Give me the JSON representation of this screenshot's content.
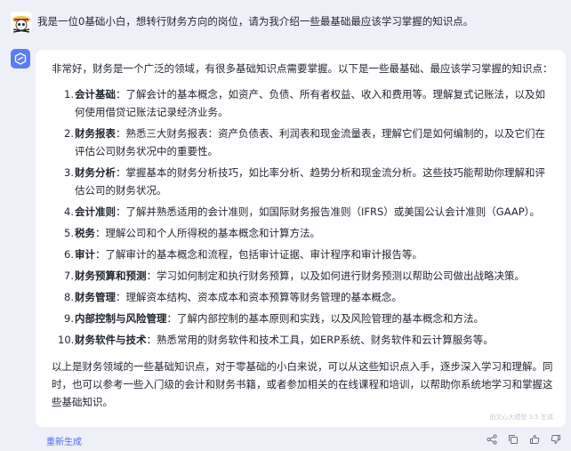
{
  "user": {
    "message": "我是一位0基础小白，想转行财务方向的岗位，请为我介绍一些最基础最应该学习掌握的知识点。"
  },
  "answer": {
    "intro": "非常好，财务是一个广泛的领域，有很多基础知识点需要掌握。以下是一些最基础、最应该学习掌握的知识点：",
    "items": [
      {
        "num": "1.",
        "term": "会计基础",
        "text": "：了解会计的基本概念，如资产、负债、所有者权益、收入和费用等。理解复式记账法，以及如何使用借贷记账法记录经济业务。"
      },
      {
        "num": "2.",
        "term": "财务报表",
        "text": "：熟悉三大财务报表：资产负债表、利润表和现金流量表，理解它们是如何编制的，以及它们在评估公司财务状况中的重要性。"
      },
      {
        "num": "3.",
        "term": "财务分析",
        "text": "：掌握基本的财务分析技巧，如比率分析、趋势分析和现金流分析。这些技巧能帮助你理解和评估公司的财务状况。"
      },
      {
        "num": "4.",
        "term": "会计准则",
        "text": "：了解并熟悉适用的会计准则，如国际财务报告准则（IFRS）或美国公认会计准则（GAAP）。"
      },
      {
        "num": "5.",
        "term": "税务",
        "text": "：理解公司和个人所得税的基本概念和计算方法。"
      },
      {
        "num": "6.",
        "term": "审计",
        "text": "：了解审计的基本概念和流程，包括审计证据、审计程序和审计报告等。"
      },
      {
        "num": "7.",
        "term": "财务预算和预测",
        "text": "：学习如何制定和执行财务预算，以及如何进行财务预测以帮助公司做出战略决策。"
      },
      {
        "num": "8.",
        "term": "财务管理",
        "text": "：理解资本结构、资本成本和资本预算等财务管理的基本概念。"
      },
      {
        "num": "9.",
        "term": "内部控制与风险管理",
        "text": "：了解内部控制的基本原则和实践，以及风险管理的基本概念和方法。"
      },
      {
        "num": "10.",
        "term": "财务软件与技术",
        "text": "：熟悉常用的财务软件和技术工具，如ERP系统、财务软件和云计算服务等。"
      }
    ],
    "conclusion": "以上是财务领域的一些基础知识点，对于零基础的小白来说，可以从这些知识点入手，逐步深入学习和理解。同时，也可以参考一些入门级的会计和财务书籍，或者参加相关的在线课程和培训，以帮助你系统地学习和掌握这些基础知识。",
    "watermark": "由文心大模型 3.5 生成"
  },
  "footer": {
    "regenerate_label": "重新生成"
  },
  "icons": [
    "share-icon",
    "copy-icon",
    "thumbs-up-icon",
    "thumbs-down-icon"
  ],
  "colors": {
    "accent": "#4f6bed",
    "background": "#eef0f7",
    "card": "#ffffff"
  }
}
